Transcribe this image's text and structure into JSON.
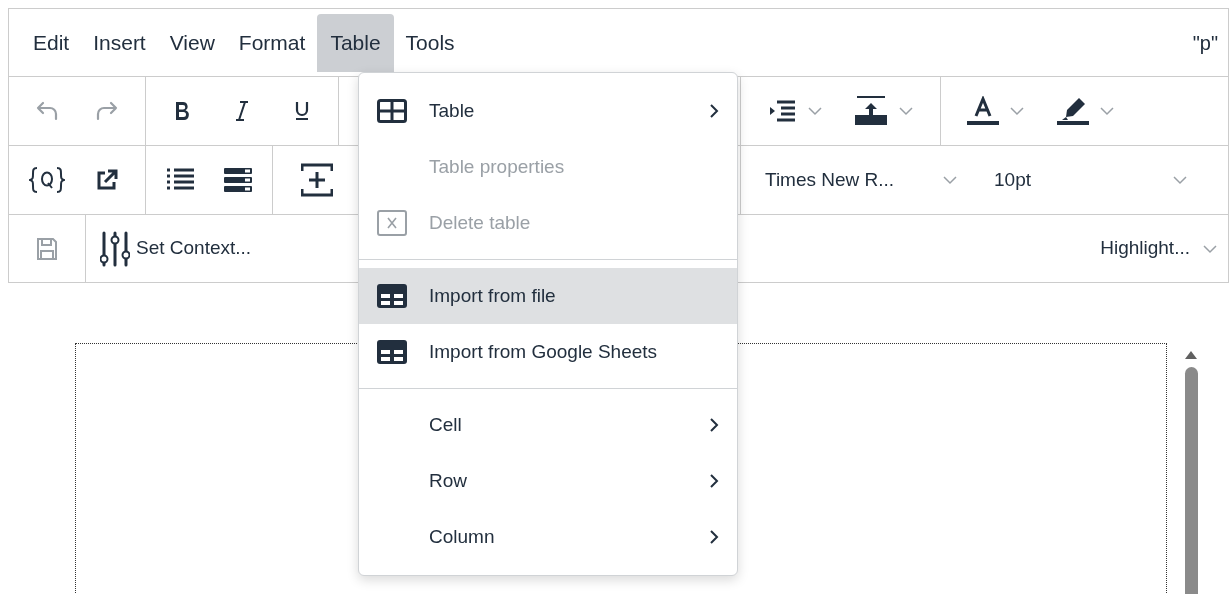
{
  "menubar": {
    "items": [
      {
        "label": "Edit",
        "selected": false
      },
      {
        "label": "Insert",
        "selected": false
      },
      {
        "label": "View",
        "selected": false
      },
      {
        "label": "Format",
        "selected": false
      },
      {
        "label": "Table",
        "selected": true
      },
      {
        "label": "Tools",
        "selected": false
      }
    ],
    "element_path": "\"p\""
  },
  "toolbar": {
    "history_buttons": [
      {
        "disabled": true
      },
      {
        "disabled": true
      }
    ],
    "save_button": {
      "disabled": true
    },
    "font_family": "Times New R...",
    "font_size": "10pt",
    "context_button": "Set Context...",
    "highlight_select": "Highlight..."
  },
  "table_menu": {
    "items": [
      {
        "kind": "grid",
        "label": "Table",
        "disabled": false,
        "selected": false,
        "submenu": true
      },
      {
        "kind": "plain",
        "label": "Table properties",
        "disabled": true,
        "selected": false,
        "submenu": false
      },
      {
        "kind": "delete",
        "label": "Delete table",
        "disabled": true,
        "selected": false,
        "submenu": false
      },
      {
        "kind": "divider"
      },
      {
        "kind": "sheet",
        "label": "Import from file",
        "disabled": false,
        "selected": true,
        "submenu": false
      },
      {
        "kind": "sheet",
        "label": "Import from Google Sheets",
        "disabled": false,
        "selected": false,
        "submenu": false
      },
      {
        "kind": "divider"
      },
      {
        "kind": "plain",
        "label": "Cell",
        "disabled": false,
        "selected": false,
        "submenu": true
      },
      {
        "kind": "plain",
        "label": "Row",
        "disabled": false,
        "selected": false,
        "submenu": true
      },
      {
        "kind": "plain",
        "label": "Column",
        "disabled": false,
        "selected": false,
        "submenu": true
      }
    ]
  }
}
